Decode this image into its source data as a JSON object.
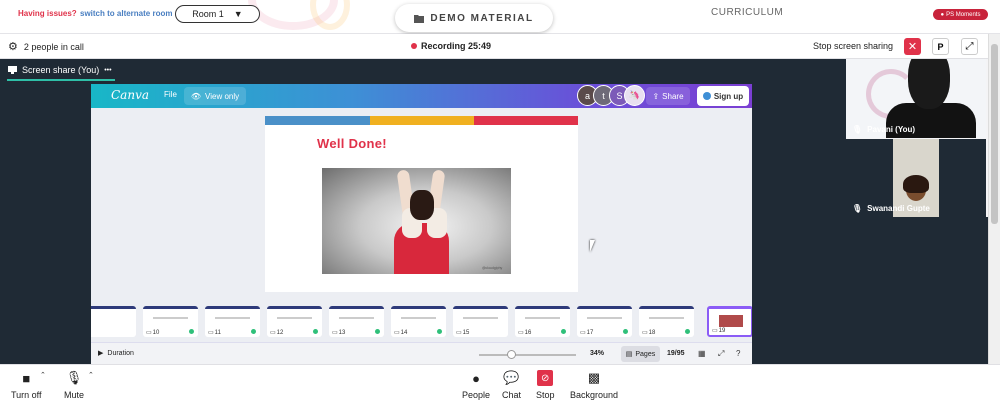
{
  "top_bar": {
    "issues_text": "Having issues?",
    "switch_link": "switch to alternate room",
    "room_select": "Room 1",
    "demo_label": "DEMO MATERIAL",
    "curriculum_label": "CURRICULUM",
    "ps_moments": "PS Moments"
  },
  "call_bar": {
    "people_count": "2 people in call",
    "recording_label": "Recording 25:49",
    "stop_sharing": "Stop screen sharing",
    "p_button": "P"
  },
  "share": {
    "tab_label": "Screen share (You)",
    "tab_more": "•••"
  },
  "canva": {
    "logo": "Canva",
    "file": "File",
    "view_only": "View only",
    "avatars": [
      {
        "letter": "a",
        "color": "#5a4a4a"
      },
      {
        "letter": "t",
        "color": "#6e6a78"
      },
      {
        "letter": "S",
        "color": "#7c5ab8"
      }
    ],
    "share": "Share",
    "signup": "Sign up"
  },
  "slide": {
    "title": "Well Done!",
    "gif_credit": "@cloudgiphy",
    "stripe_colors": [
      "#4a90c8",
      "#f0b020",
      "#e0324a"
    ]
  },
  "thumbnails": [
    {
      "num": "",
      "check": false
    },
    {
      "num": "10",
      "check": true
    },
    {
      "num": "11",
      "check": true
    },
    {
      "num": "12",
      "check": true
    },
    {
      "num": "13",
      "check": true
    },
    {
      "num": "14",
      "check": true
    },
    {
      "num": "15",
      "check": false
    },
    {
      "num": "16",
      "check": true
    },
    {
      "num": "17",
      "check": true
    },
    {
      "num": "18",
      "check": true
    },
    {
      "num": "19",
      "check": false
    }
  ],
  "bottom_strip": {
    "duration": "Duration",
    "zoom": "34%",
    "pages": "Pages",
    "page_count": "19/95"
  },
  "participants": [
    {
      "name": "Pavani (You)"
    },
    {
      "name": "Swanandi Gupte"
    }
  ],
  "toolbar": {
    "turn_off": "Turn off",
    "mute": "Mute",
    "people": "People",
    "chat": "Chat",
    "stop": "Stop",
    "background": "Background"
  },
  "colors": {
    "accent_red": "#e0324a",
    "teal": "#2fc0a8",
    "dark_bg": "#1f2a35"
  }
}
